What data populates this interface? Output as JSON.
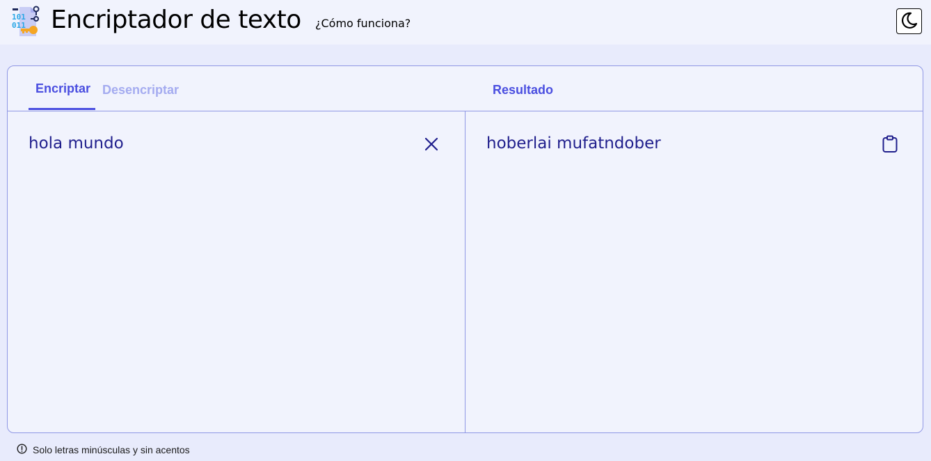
{
  "header": {
    "title": "Encriptador de texto",
    "how_link": "¿Cómo funciona?",
    "logo_icon": "binary-key-icon",
    "theme_icon": "moon-icon"
  },
  "tabs": {
    "encrypt": "Encriptar",
    "decrypt": "Desencriptar",
    "active": "Encriptar"
  },
  "result": {
    "label": "Resultado",
    "value": "hoberlai mufatndober",
    "copy_icon": "clipboard-icon"
  },
  "input": {
    "value": "hola mundo",
    "clear_icon": "close-icon"
  },
  "hint": {
    "text": "Solo letras minúsculas y sin acentos",
    "icon": "info-circle-icon"
  },
  "colors": {
    "accent": "#4a4ee0",
    "accent_muted": "#a4abf0",
    "text_dark": "#1f1e8c",
    "border": "#8f97e4",
    "background": "#e8ebfc",
    "surface": "#f1f3fd"
  }
}
